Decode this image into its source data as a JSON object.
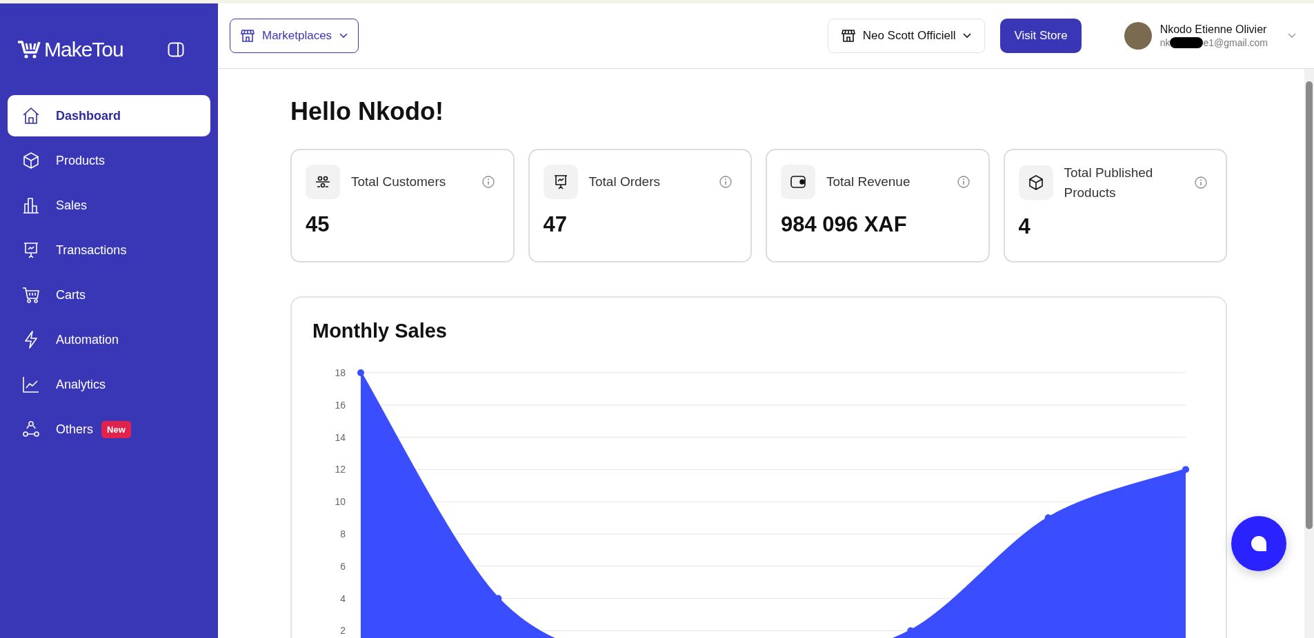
{
  "sidebar": {
    "logo": "MakeTou",
    "items": [
      {
        "label": "Dashboard",
        "selected": true
      },
      {
        "label": "Products",
        "selected": false
      },
      {
        "label": "Sales",
        "selected": false
      },
      {
        "label": "Transactions",
        "selected": false
      },
      {
        "label": "Carts",
        "selected": false
      },
      {
        "label": "Automation",
        "selected": false
      },
      {
        "label": "Analytics",
        "selected": false
      },
      {
        "label": "Others",
        "selected": false,
        "badge": "New"
      }
    ]
  },
  "header": {
    "marketplaces": "Marketplaces",
    "store": "Neo Scott Officiell",
    "visit_button": "Visit Store",
    "user": {
      "name": "Nkodo Etienne Olivier",
      "email_start": "nk",
      "email_end": "e1@gmail.com"
    }
  },
  "greeting": "Hello Nkodo!",
  "stats": [
    {
      "label": "Total Customers",
      "value": "45"
    },
    {
      "label": "Total Orders",
      "value": "47"
    },
    {
      "label": "Total Revenue",
      "value": "984 096 XAF"
    },
    {
      "label": "Total Published Products",
      "value": "4"
    }
  ],
  "monthly_sales": {
    "title": "Monthly Sales",
    "chart_data": {
      "type": "area",
      "values": [
        18,
        4,
        0,
        0,
        2,
        9,
        12
      ],
      "ylim": [
        0,
        18
      ],
      "grid": true,
      "yticks": [
        2,
        4,
        6,
        8,
        10,
        12,
        14,
        16,
        18
      ]
    }
  }
}
